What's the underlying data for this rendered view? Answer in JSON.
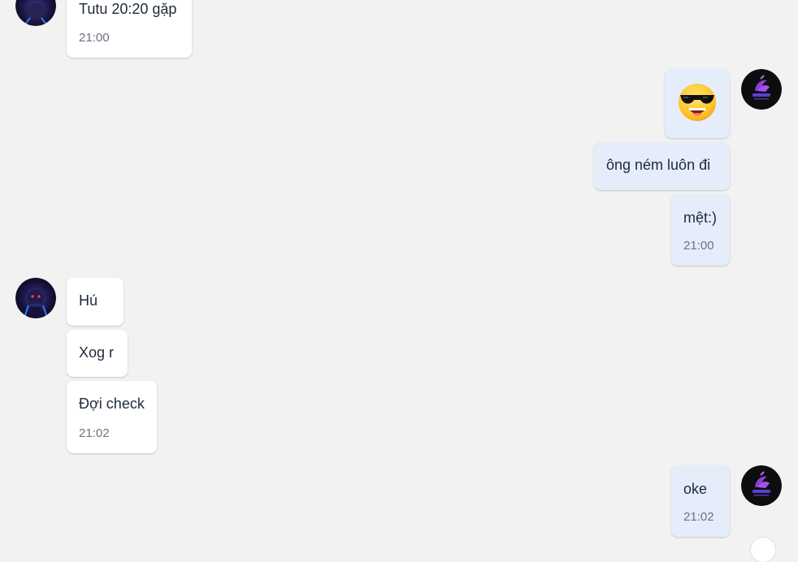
{
  "colors": {
    "background": "#f2f2f2",
    "incoming_bubble": "#ffffff",
    "outgoing_bubble": "#e5edfb",
    "timestamp": "#6b7280",
    "text": "#1f2a37"
  },
  "messages": [
    {
      "side": "incoming",
      "text": "Tutu 20:20 gặp",
      "time": "21:00"
    },
    {
      "side": "outgoing",
      "text": "",
      "emoji": "smiling-face-with-sunglasses-emoji"
    },
    {
      "side": "outgoing",
      "text": "ông ném luôn đi"
    },
    {
      "side": "outgoing",
      "text": "mệt:)",
      "time": "21:00"
    },
    {
      "side": "incoming",
      "text": "Hú"
    },
    {
      "side": "incoming",
      "text": "Xog r"
    },
    {
      "side": "incoming",
      "text": "Đợi check",
      "time": "21:02"
    },
    {
      "side": "outgoing",
      "text": "oke",
      "time": "21:02"
    }
  ],
  "avatars": {
    "incoming": "dark-anime-avatar",
    "outgoing": "nct-logo-avatar"
  }
}
